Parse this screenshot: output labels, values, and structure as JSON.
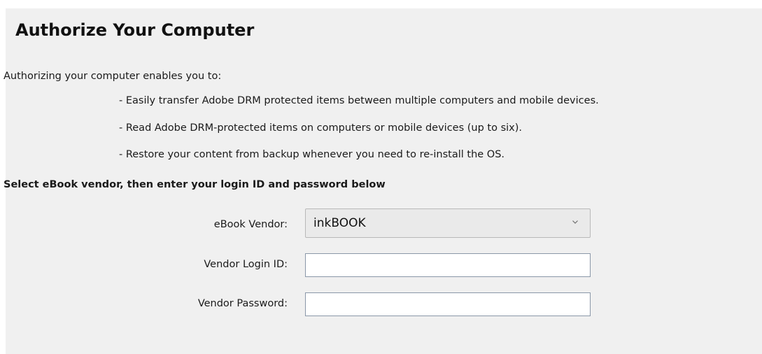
{
  "dialog": {
    "title": "Authorize Your Computer",
    "intro": "Authorizing your computer enables you to:",
    "benefits": [
      "- Easily transfer Adobe DRM protected items between multiple computers and mobile devices.",
      "- Read Adobe DRM-protected items on computers or mobile devices (up to six).",
      "- Restore your content from backup whenever you need to re-install the OS."
    ],
    "section_heading": "Select eBook vendor, then enter your login ID and password below"
  },
  "form": {
    "vendor_label": "eBook Vendor:",
    "vendor_selected": "inkBOOK",
    "login_label": "Vendor Login ID:",
    "login_value": "",
    "password_label": "Vendor Password:",
    "password_value": ""
  },
  "icons": {
    "vendor_dropdown": "chevron-down-icon"
  },
  "colors": {
    "panel_background": "#f0f0f0",
    "field_border": "#8a97a8"
  }
}
